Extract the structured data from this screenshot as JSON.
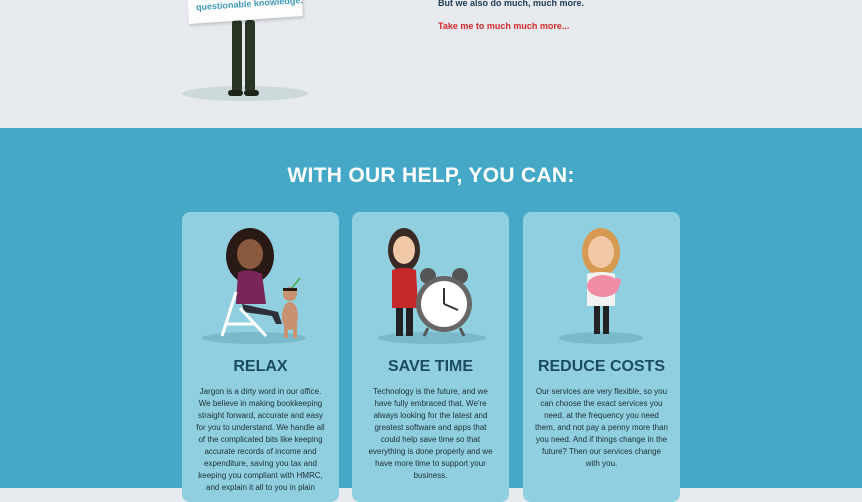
{
  "hero": {
    "sign_text": "questionable knowledge.",
    "line_text": "But we also do much, much more.",
    "link_text": "Take me to much much more..."
  },
  "help": {
    "title": "WITH OUR HELP, YOU CAN:",
    "cards": [
      {
        "title": "RELAX",
        "text": "Jargon is a dirty word in our office. We believe in making bookkeeping straight forward, accurate and easy for you to understand. We handle all of the complicated bits like keeping accurate records of income and expenditure, saving you tax and keeping you compliant with HMRC, and explain it all to you in plain"
      },
      {
        "title": "SAVE TIME",
        "text": "Technology is the future, and we have fully embraced that. We're always looking for the latest and greatest software and apps that could help save time so that everything is done properly and we have more time to support your business."
      },
      {
        "title": "REDUCE COSTS",
        "text": "Our services are very flexible, so you can choose the exact services you need, at the frequency you need them, and not pay a penny more than you need. And if things change in the future? Then our services change with you."
      }
    ]
  }
}
